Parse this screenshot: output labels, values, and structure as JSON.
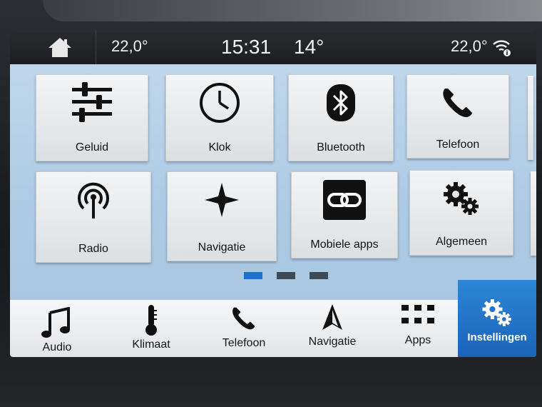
{
  "status": {
    "temp_left": "22,0°",
    "clock": "15:31",
    "outside_temp": "14°",
    "temp_right": "22,0°"
  },
  "colors": {
    "accent": "#1e6fd1",
    "panel": "#b5cfe6",
    "tile": "#eceef0",
    "icon": "#111111"
  },
  "tiles": [
    {
      "label": "Geluid",
      "icon": "sliders-icon"
    },
    {
      "label": "Klok",
      "icon": "clock-icon"
    },
    {
      "label": "Bluetooth",
      "icon": "bluetooth-icon"
    },
    {
      "label": "Telefoon",
      "icon": "phone-icon"
    },
    {
      "label": "Radio",
      "icon": "radio-antenna-icon"
    },
    {
      "label": "Navigatie",
      "icon": "compass-star-icon"
    },
    {
      "label": "Mobiele apps",
      "icon": "link-icon"
    },
    {
      "label": "Algemeen",
      "icon": "gears-icon"
    }
  ],
  "pager": {
    "pages": 3,
    "current": 1
  },
  "nav": [
    {
      "label": "Audio",
      "icon": "music-note-icon"
    },
    {
      "label": "Klimaat",
      "icon": "thermometer-icon"
    },
    {
      "label": "Telefoon",
      "icon": "phone-icon"
    },
    {
      "label": "Navigatie",
      "icon": "navigation-arrow-icon"
    },
    {
      "label": "Apps",
      "icon": "apps-grid-icon"
    },
    {
      "label": "Instellingen",
      "icon": "gears-icon",
      "active": true
    }
  ]
}
